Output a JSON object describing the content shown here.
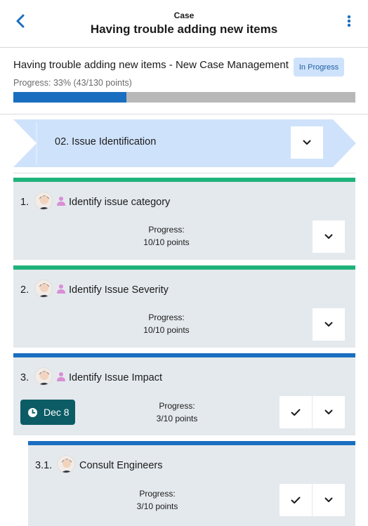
{
  "header": {
    "small_title": "Case",
    "title": "Having trouble adding new items",
    "back_icon": "chevron-left-icon",
    "menu_icon": "more-vertical-icon"
  },
  "case": {
    "name": "Having trouble adding new items - New Case Management",
    "status": "In Progress",
    "progress_text": "Progress: 33% (43/130 points)",
    "progress_fraction": 0.33
  },
  "stage": {
    "label": "02. Issue Identification",
    "dropdown_icon": "chevron-down-icon"
  },
  "tasks": [
    {
      "number": "1.",
      "title": "Identify issue category",
      "progress_label": "Progress:",
      "progress_value": "10/10 points",
      "accent": "#1fb37a"
    },
    {
      "number": "2.",
      "title": "Identify Issue Severity",
      "progress_label": "Progress:",
      "progress_value": "10/10 points",
      "accent": "#1fb37a"
    },
    {
      "number": "3.",
      "title": "Identify Issue Impact",
      "progress_label": "Progress:",
      "progress_value": "3/10 points",
      "date": "Dec 8",
      "accent": "#1a6ebf"
    },
    {
      "number": "3.1.",
      "title": "Consult Engineers",
      "progress_label": "Progress:",
      "progress_value": "3/10 points",
      "accent": "#1a6ebf"
    }
  ],
  "colors": {
    "accent_blue": "#1a6ebf",
    "accent_green": "#1fb37a",
    "stage_fill": "#cfe2fb",
    "card_bg": "#e4e9ed",
    "date_badge": "#0c5c65",
    "person_icon": "#d98ed6"
  }
}
